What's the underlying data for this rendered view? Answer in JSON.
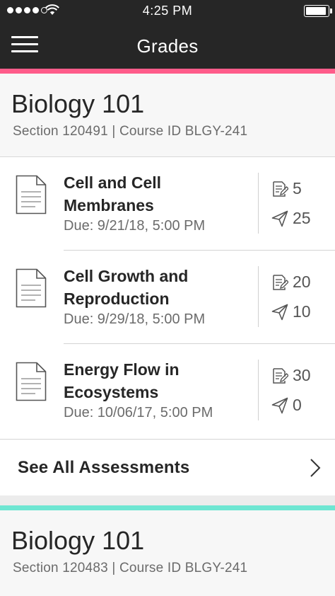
{
  "status_bar": {
    "time": "4:25 PM",
    "signal_bars": 4,
    "signal_total": 5,
    "battery_level": 0.85
  },
  "nav": {
    "title": "Grades",
    "menu_icon": "hamburger-menu-icon"
  },
  "courses": [
    {
      "title": "Biology 101",
      "subtitle": "Section 120491 | Course ID BLGY-241",
      "accent_color": "#ff5c8a",
      "assessments": [
        {
          "title": "Cell and Cell Membranes",
          "due": "Due: 9/21/18, 5:00 PM",
          "graded": "5",
          "submitted": "25"
        },
        {
          "title": "Cell Growth and Reproduction",
          "due": "Due: 9/29/18, 5:00 PM",
          "graded": "20",
          "submitted": "10"
        },
        {
          "title": "Energy Flow in Ecosystems",
          "due": "Due: 10/06/17, 5:00 PM",
          "graded": "30",
          "submitted": "0"
        }
      ],
      "see_all_label": "See All Assessments"
    },
    {
      "title": "Biology 101",
      "subtitle": "Section 120483 | Course ID BLGY-241",
      "accent_color": "#6ee6d2"
    }
  ],
  "icons": {
    "assessment": "document-icon",
    "graded": "graded-doc-icon",
    "submitted": "send-icon",
    "chevron": "chevron-right-icon"
  }
}
